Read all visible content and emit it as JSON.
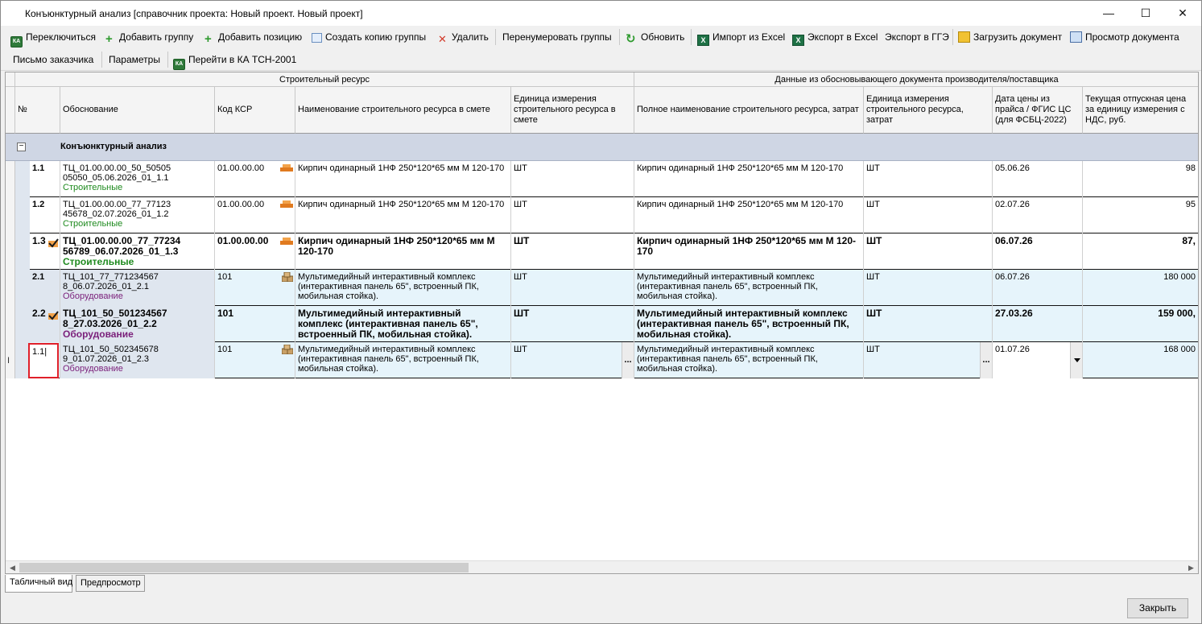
{
  "window": {
    "title": "Конъюнктурный анализ [справочник проекта: Новый проект. Новый проект]",
    "minimize": "—",
    "maximize": "☐",
    "close": "✕"
  },
  "toolbar1": {
    "switch": "Переключиться",
    "add_group": "Добавить группу",
    "add_position": "Добавить позицию",
    "copy_group": "Создать копию группы",
    "delete": "Удалить",
    "renumber": "Перенумеровать группы",
    "refresh": "Обновить",
    "import_excel": "Импорт из Excel",
    "export_excel": "Экспорт в Excel",
    "export_gge": "Экспорт в ГГЭ",
    "load_doc": "Загрузить документ",
    "view_doc": "Просмотр документа"
  },
  "toolbar2": {
    "letter": "Письмо заказчика",
    "params": "Параметры",
    "goto_ka": "Перейти в КА ТСН-2001"
  },
  "grid": {
    "band_resource": "Строительный ресурс",
    "band_supplier": "Данные из обосновывающего документа производителя/поставщика",
    "columns": [
      "№",
      "Обоснование",
      "Код КСР",
      "Наименование строительного ресурса в смете",
      "Единица измерения строительного ресурса в смете",
      "Полное наименование строительного ресурса, затрат",
      "Единица измерения строительного ресурса, затрат",
      "Дата цены из прайса / ФГИС ЦС (для ФСБЦ-2022)",
      "Текущая отпускная цена за единицу измерения с НДС, руб."
    ],
    "group_label": "Конъюнктурный анализ",
    "group_toggle": "−",
    "rows": [
      {
        "num": "1.1",
        "basis1": "ТЦ_01.00.00.00_50_50505",
        "basis2": "05050_05.06.2026_01_1.1",
        "category": "Строительные",
        "code": "01.00.00.00",
        "name": "Кирпич одинарный 1НФ 250*120*65 мм М 120-170",
        "unit": "ШТ",
        "fullname": "Кирпич одинарный 1НФ 250*120*65 мм М 120-170",
        "unit2": "ШТ",
        "date": "05.06.26",
        "price": "98"
      },
      {
        "num": "1.2",
        "basis1": "ТЦ_01.00.00.00_77_77123",
        "basis2": "45678_02.07.2026_01_1.2",
        "category": "Строительные",
        "code": "01.00.00.00",
        "name": "Кирпич одинарный 1НФ 250*120*65 мм М 120-170",
        "unit": "ШТ",
        "fullname": "Кирпич одинарный 1НФ 250*120*65 мм М 120-170",
        "unit2": "ШТ",
        "date": "02.07.26",
        "price": "95"
      },
      {
        "num": "1.3",
        "basis1": "ТЦ_01.00.00.00_77_77234",
        "basis2": "56789_06.07.2026_01_1.3",
        "category": "Строительные",
        "code": "01.00.00.00",
        "name": "Кирпич одинарный 1НФ 250*120*65 мм М 120-170",
        "unit": "ШТ",
        "fullname": "Кирпич одинарный 1НФ 250*120*65 мм М 120-170",
        "unit2": "ШТ",
        "date": "06.07.26",
        "price": "87,"
      },
      {
        "num": "2.1",
        "basis1": "ТЦ_101_77_771234567",
        "basis2": "8_06.07.2026_01_2.1",
        "category": "Оборудование",
        "code": "101",
        "name": "Мультимедийный интерактивный комплекс (интерактивная панель 65\", встроенный ПК, мобильная стойка).",
        "unit": "ШТ",
        "fullname": "Мультимедийный интерактивный комплекс (интерактивная панель 65\", встроенный ПК, мобильная стойка).",
        "unit2": "ШТ",
        "date": "06.07.26",
        "price": "180 000"
      },
      {
        "num": "2.2",
        "basis1": "ТЦ_101_50_501234567",
        "basis2": "8_27.03.2026_01_2.2",
        "category": "Оборудование",
        "code": "101",
        "name": "Мультимедийный интерактивный комплекс (интерактивная панель 65\", встроенный ПК, мобильная стойка).",
        "unit": "ШТ",
        "fullname": "Мультимедийный интерактивный комплекс (интерактивная панель 65\", встроенный ПК, мобильная стойка).",
        "unit2": "ШТ",
        "date": "27.03.26",
        "price": "159 000,"
      },
      {
        "num": "1.1",
        "basis1": "ТЦ_101_50_502345678",
        "basis2": "9_01.07.2026_01_2.3",
        "category": "Оборудование",
        "code": "101",
        "name": "Мультимедийный интерактивный комплекс (интерактивная панель 65\", встроенный ПК, мобильная стойка).",
        "unit": "ШТ",
        "fullname": "Мультимедийный интерактивный комплекс (интерактивная панель 65\", встроенный ПК, мобильная стойка).",
        "unit2": "ШТ",
        "date": "01.07.26",
        "price": "168 000"
      }
    ],
    "edit_value": "1.1|",
    "ellipsis": "...",
    "scroll_left": "◀",
    "scroll_right": "▶"
  },
  "tabs": {
    "table": "Табличный вид",
    "preview": "Предпросмотр"
  },
  "footer": {
    "close": "Закрыть"
  },
  "colors": {
    "group_bg": "#cfd6e4",
    "equip_bg": "#e6f4fb",
    "edit_border": "#e0202a",
    "green_text": "#1e8a1e",
    "purple_text": "#7a1f7a"
  }
}
